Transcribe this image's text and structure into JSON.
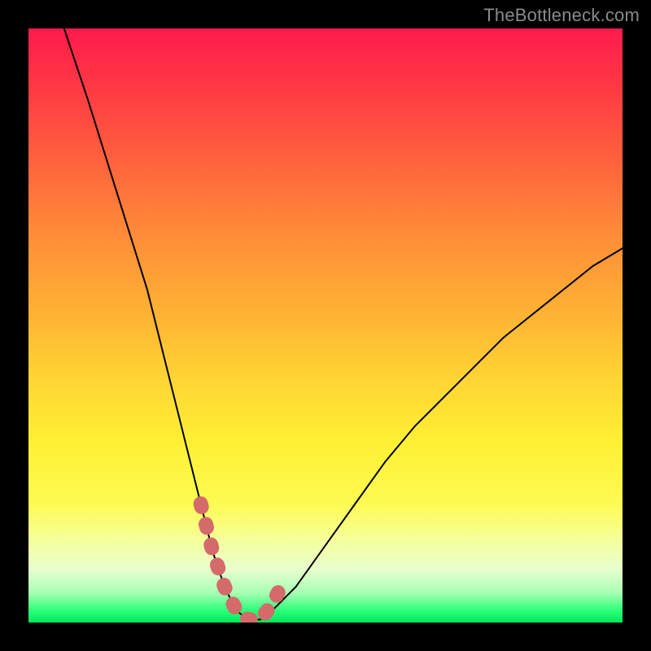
{
  "watermark": "TheBottleneck.com",
  "colors": {
    "background": "#000000",
    "curve_stroke": "#000000",
    "marker_fill": "#d46a6a",
    "gradient_top": "#ff1a4d",
    "gradient_bottom": "#00e85a"
  },
  "chart_data": {
    "type": "line",
    "title": "",
    "xlabel": "",
    "ylabel": "",
    "xlim": [
      0,
      100
    ],
    "ylim": [
      0,
      100
    ],
    "note": "Bottleneck-style V-curve. y is bottleneck percentage (lower is better, green band near 0). Values estimated from pixel positions; no axis ticks visible.",
    "series": [
      {
        "name": "bottleneck-curve",
        "x": [
          6,
          10,
          15,
          20,
          24,
          27,
          29,
          31,
          33,
          35,
          37,
          39,
          41,
          45,
          50,
          55,
          60,
          65,
          70,
          75,
          80,
          85,
          90,
          95,
          100
        ],
        "y": [
          100,
          88,
          72,
          56,
          40,
          28,
          20,
          12,
          6,
          2,
          0.5,
          0.5,
          2,
          6,
          13,
          20,
          27,
          33,
          38,
          43,
          48,
          52,
          56,
          60,
          63
        ]
      }
    ],
    "markers": {
      "name": "highlighted-range",
      "x": [
        29,
        31,
        33,
        35,
        37,
        39,
        41,
        43
      ],
      "y": [
        20,
        12,
        6,
        2,
        0.5,
        0.5,
        3,
        7
      ]
    }
  }
}
